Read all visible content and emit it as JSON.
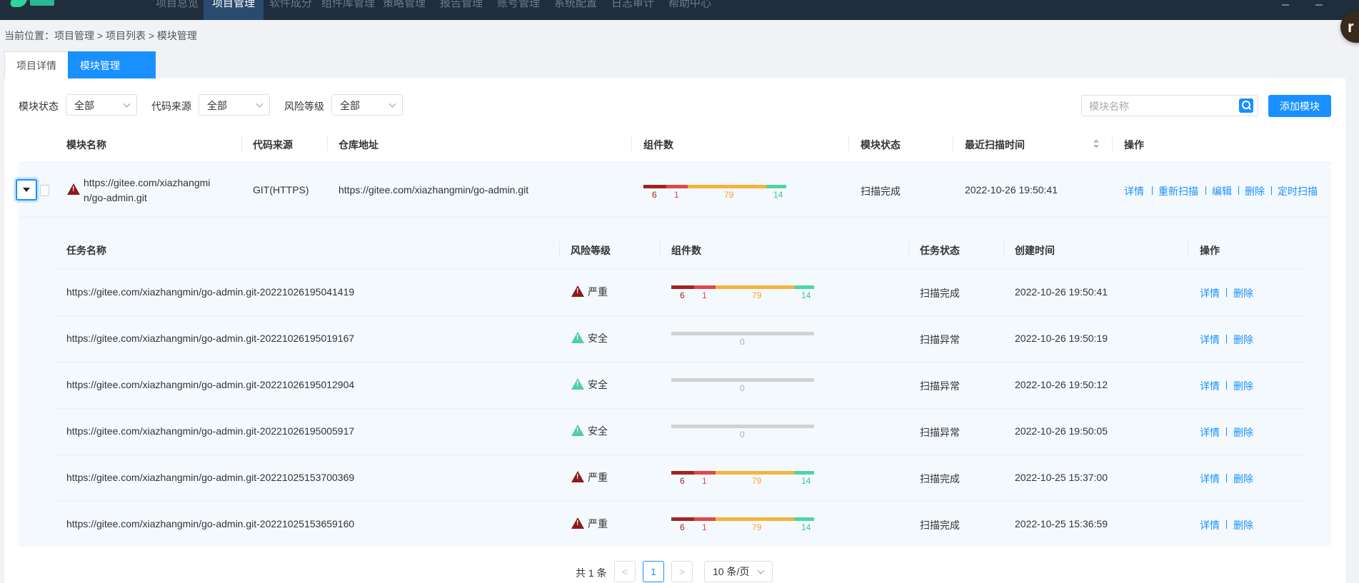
{
  "nav": {
    "items": [
      "项目总览",
      "项目管理",
      "软件成分",
      "组件库管理",
      "策略管理",
      "报告管理",
      "账号管理",
      "系统配置",
      "日志审计",
      "帮助中心"
    ],
    "active_index": 1,
    "avatar_letter": "r"
  },
  "breadcrumb": "当前位置：项目管理 > 项目列表 > 模块管理",
  "tabs": [
    "项目详情",
    "模块管理"
  ],
  "filters": {
    "status_label": "模块状态",
    "status_value": "全部",
    "source_label": "代码来源",
    "source_value": "全部",
    "risk_label": "风险等级",
    "risk_value": "全部",
    "search_placeholder": "模块名称",
    "add_button": "添加模块"
  },
  "module_table": {
    "headers": [
      "模块名称",
      "代码来源",
      "仓库地址",
      "组件数",
      "模块状态",
      "最近扫描时间",
      "操作"
    ],
    "row": {
      "name_line1": "https://gitee.com/xiazhangmi",
      "name_line2": "n/go-admin.git",
      "source": "GIT(HTTPS)",
      "repo": "https://gitee.com/xiazhangmin/go-admin.git",
      "components": {
        "critical": 6,
        "high": 1,
        "medium": 79,
        "low": 14
      },
      "status": "扫描完成",
      "last_scan": "2022-10-26 19:50:41",
      "actions": [
        "详情",
        "重新扫描",
        "编辑",
        "删除",
        "定时扫描"
      ]
    }
  },
  "task_table": {
    "headers": [
      "任务名称",
      "风险等级",
      "组件数",
      "任务状态",
      "创建时间",
      "操作"
    ],
    "rows": [
      {
        "name": "https://gitee.com/xiazhangmin/go-admin.git-20221026195041419",
        "risk": "严重",
        "risk_type": "severe",
        "components": {
          "critical": 6,
          "high": 1,
          "medium": 79,
          "low": 14
        },
        "status": "扫描完成",
        "created": "2022-10-26 19:50:41"
      },
      {
        "name": "https://gitee.com/xiazhangmin/go-admin.git-20221026195019167",
        "risk": "安全",
        "risk_type": "safe",
        "components": {
          "total": 0
        },
        "status": "扫描异常",
        "created": "2022-10-26 19:50:19"
      },
      {
        "name": "https://gitee.com/xiazhangmin/go-admin.git-20221026195012904",
        "risk": "安全",
        "risk_type": "safe",
        "components": {
          "total": 0
        },
        "status": "扫描异常",
        "created": "2022-10-26 19:50:12"
      },
      {
        "name": "https://gitee.com/xiazhangmin/go-admin.git-20221026195005917",
        "risk": "安全",
        "risk_type": "safe",
        "components": {
          "total": 0
        },
        "status": "扫描异常",
        "created": "2022-10-26 19:50:05"
      },
      {
        "name": "https://gitee.com/xiazhangmin/go-admin.git-20221025153700369",
        "risk": "严重",
        "risk_type": "severe",
        "components": {
          "critical": 6,
          "high": 1,
          "medium": 79,
          "low": 14
        },
        "status": "扫描完成",
        "created": "2022-10-25 15:37:00"
      },
      {
        "name": "https://gitee.com/xiazhangmin/go-admin.git-20221025153659160",
        "risk": "严重",
        "risk_type": "severe",
        "components": {
          "critical": 6,
          "high": 1,
          "medium": 79,
          "low": 14
        },
        "status": "扫描完成",
        "created": "2022-10-25 15:36:59"
      }
    ],
    "actions": [
      "详情",
      "删除"
    ]
  },
  "pagination": {
    "total_text": "共 1 条",
    "prev": "<",
    "current_page": "1",
    "next": ">",
    "page_size": "10 条/页"
  },
  "colors": {
    "primary": "#1890ff",
    "critical": "#a32323",
    "high": "#e0484a",
    "medium": "#f6b33a",
    "low": "#4fd5a2",
    "nav_bg": "#1f2d3d"
  }
}
